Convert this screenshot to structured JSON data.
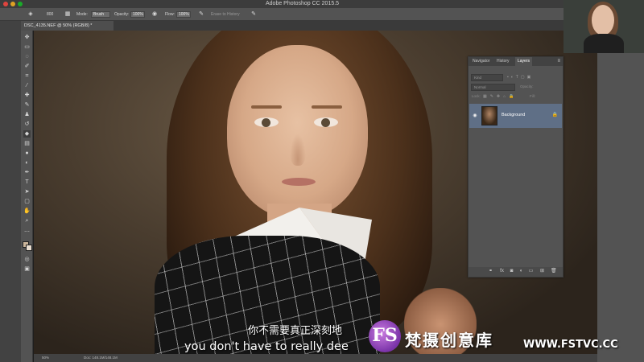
{
  "app": {
    "title": "Adobe Photoshop CC 2015.5"
  },
  "options_bar": {
    "brush_size": "800",
    "mode_label": "Mode:",
    "mode_value": "Brush",
    "opacity_label": "Opacity:",
    "opacity_value": "100%",
    "flow_label": "Flow:",
    "flow_value": "100%",
    "erase_to_history": "Erase to History"
  },
  "document": {
    "tab_label": "DSC_4135.NEF @ 50% (RGB/8) *"
  },
  "toolbar": {
    "tools": [
      "move-tool",
      "marquee-tool",
      "lasso-tool",
      "quick-select-tool",
      "crop-tool",
      "eyedropper-tool",
      "healing-tool",
      "brush-tool",
      "clone-stamp-tool",
      "history-brush-tool",
      "eraser-tool",
      "gradient-tool",
      "blur-tool",
      "dodge-tool",
      "pen-tool",
      "type-tool",
      "path-select-tool",
      "shape-tool",
      "hand-tool",
      "zoom-tool"
    ]
  },
  "layers_panel": {
    "tabs": [
      "Navigator",
      "History",
      "Layers"
    ],
    "active_tab": "Layers",
    "kind_placeholder": "Kind",
    "blend_mode": "Normal",
    "opacity_label": "Opacity:",
    "lock_label": "Lock:",
    "fill_label": "Fill:",
    "layers": [
      {
        "name": "Background",
        "visible": true,
        "locked": true
      }
    ]
  },
  "status_bar": {
    "zoom": "50%",
    "doc_size": "Doc: 148.1M/148.1M"
  },
  "subtitles": {
    "chinese": "你不需要真正深刻地",
    "english": "you don't have to really dee"
  },
  "watermark": {
    "mark": "FS",
    "name": "梵摄创意库",
    "url": "WWW.FSTVC.CC"
  },
  "colors": {
    "panel_bg": "#535353",
    "active_layer": "#5f6f86",
    "watermark_accent": "#7a33a8"
  }
}
